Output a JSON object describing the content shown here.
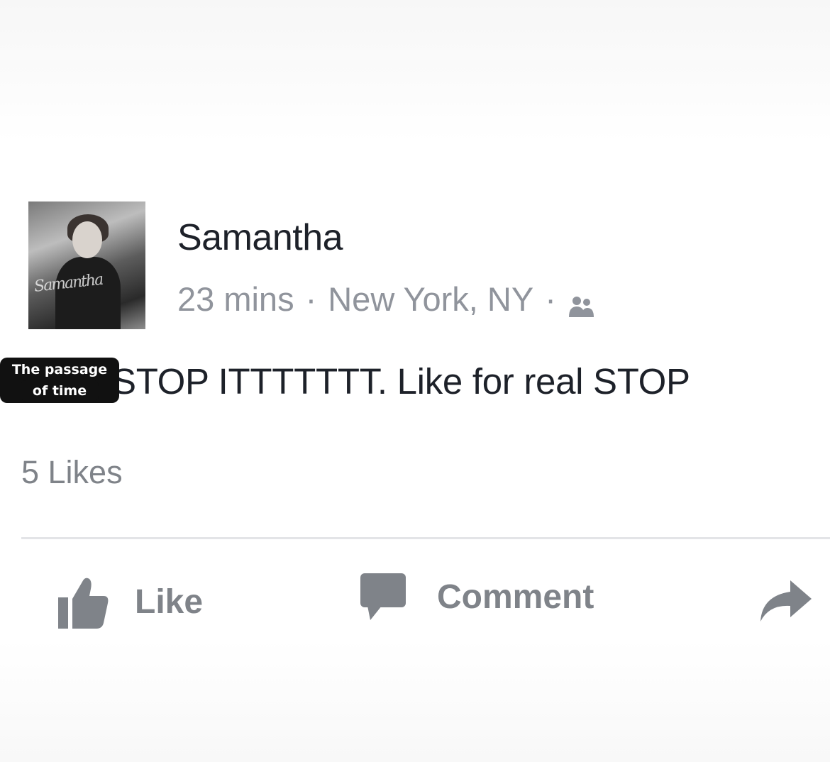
{
  "post": {
    "author": "Samantha",
    "time": "23 mins",
    "separator": "·",
    "location": "New York, NY",
    "audience_icon": "friends-icon",
    "status_text": "STOP ITTTTTTT. Like for real STOP",
    "likes_count": "5 Likes"
  },
  "sticker": {
    "line1": "The passage",
    "line2": "of time"
  },
  "actions": {
    "like_label": "Like",
    "comment_label": "Comment",
    "share_icon": "share-arrow-icon"
  },
  "colors": {
    "text_primary": "#1d2129",
    "text_secondary": "#90949c",
    "action_gray": "#7f8389"
  }
}
